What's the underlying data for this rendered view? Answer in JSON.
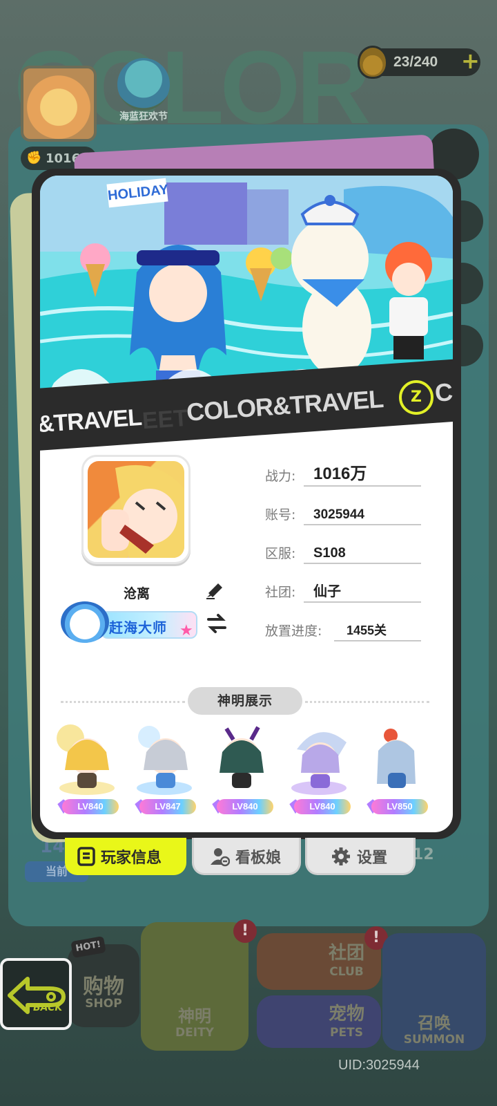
{
  "background": {
    "stamina": "23/240",
    "event_label": "海蓝狂欢节",
    "power_short": "1016",
    "stage_number": "14",
    "stage_label": "当前",
    "count_label": "/12",
    "nav": {
      "shop_hot": "HOT!",
      "shop_main": "购物",
      "shop_sub": "SHOP",
      "deity_main": "神明",
      "deity_sub": "DEITY",
      "club_main": "社团",
      "club_sub": "CLUB",
      "pets_main": "宠物",
      "pets_sub": "PETS",
      "summon_main": "召唤",
      "summon_sub": "SUMMON",
      "alert": "!"
    },
    "back_label": "BACK",
    "uid": "UID:3025944"
  },
  "card": {
    "banner_sign": "HOLIDAY",
    "strip_main": "COLOR&TRAVEL",
    "strip_left": "&TRAVEL",
    "strip_ghost": "EET",
    "strip_badge": "Z",
    "strip_cont": "CO",
    "player": {
      "name": "沧离",
      "title_badge": "赶海大师"
    },
    "info": [
      {
        "label": "战力:",
        "value": "1016万"
      },
      {
        "label": "账号:",
        "value": "3025944"
      },
      {
        "label": "区服:",
        "value": "S108"
      },
      {
        "label": "社团:",
        "value": "仙子"
      },
      {
        "label": "放置进度:",
        "value": "1455关"
      }
    ],
    "deity_section_title": "神明展示",
    "deities": [
      {
        "level": "LV840",
        "color": "#f3c64a"
      },
      {
        "level": "LV847",
        "color": "#7fc7ff"
      },
      {
        "level": "LV840",
        "color": "#2f7a6a"
      },
      {
        "level": "LV840",
        "color": "#b48cf2"
      },
      {
        "level": "LV850",
        "color": "#9fc3e8"
      }
    ]
  },
  "tabs": [
    {
      "label": "玩家信息",
      "icon": "document-icon",
      "active": true
    },
    {
      "label": "看板娘",
      "icon": "person-icon",
      "active": false
    },
    {
      "label": "设置",
      "icon": "gear-icon",
      "active": false
    }
  ]
}
